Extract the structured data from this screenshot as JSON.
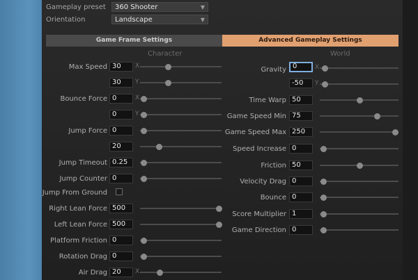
{
  "top": {
    "gameplay_preset_label": "Gameplay preset",
    "gameplay_preset_value": "360 Shooter",
    "orientation_label": "Orientation",
    "orientation_value": "Landscape"
  },
  "tabs": [
    {
      "label": "Game Frame Settings",
      "active": false
    },
    {
      "label": "Advanced Gameplay Settings",
      "active": true
    }
  ],
  "character": {
    "title": "Character",
    "max_speed_label": "Max Speed",
    "max_speed_x": "30",
    "max_speed_y": "30",
    "bounce_force_label": "Bounce Force",
    "bounce_force_x": "0",
    "bounce_force_y": "0",
    "jump_force_label": "Jump Force",
    "jump_force_a": "0",
    "jump_force_b": "20",
    "jump_timeout_label": "Jump Timeout",
    "jump_timeout": "0.25",
    "jump_counter_label": "Jump Counter",
    "jump_counter": "0",
    "jump_from_ground_label": "Jump From Ground",
    "right_lean_force_label": "Right Lean Force",
    "right_lean_force": "500",
    "left_lean_force_label": "Left Lean Force",
    "left_lean_force": "500",
    "platform_friction_label": "Platform Friction",
    "platform_friction": "0",
    "rotation_drag_label": "Rotation Drag",
    "rotation_drag": "0",
    "air_drag_label": "Air Drag",
    "air_drag": "20"
  },
  "world": {
    "title": "World",
    "gravity_label": "Gravity",
    "gravity_x": "0",
    "gravity_y": "-50",
    "time_warp_label": "Time Warp",
    "time_warp": "50",
    "game_speed_min_label": "Game Speed Min",
    "game_speed_min": "75",
    "game_speed_max_label": "Game Speed Max",
    "game_speed_max": "250",
    "speed_increase_label": "Speed Increase",
    "speed_increase": "0",
    "friction_label": "Friction",
    "friction": "50",
    "velocity_drag_label": "Velocity Drag",
    "velocity_drag": "0",
    "bounce_label": "Bounce",
    "bounce": "0",
    "score_multiplier_label": "Score Multiplier",
    "score_multiplier": "1",
    "game_direction_label": "Game Direction",
    "game_direction": "0"
  },
  "axes": {
    "x": "X",
    "y": "Y"
  },
  "icons": {
    "dropdown": "chevron-down-icon"
  },
  "colors": {
    "active_tab": "#e1a070",
    "focus_border": "#7fb0e0"
  }
}
